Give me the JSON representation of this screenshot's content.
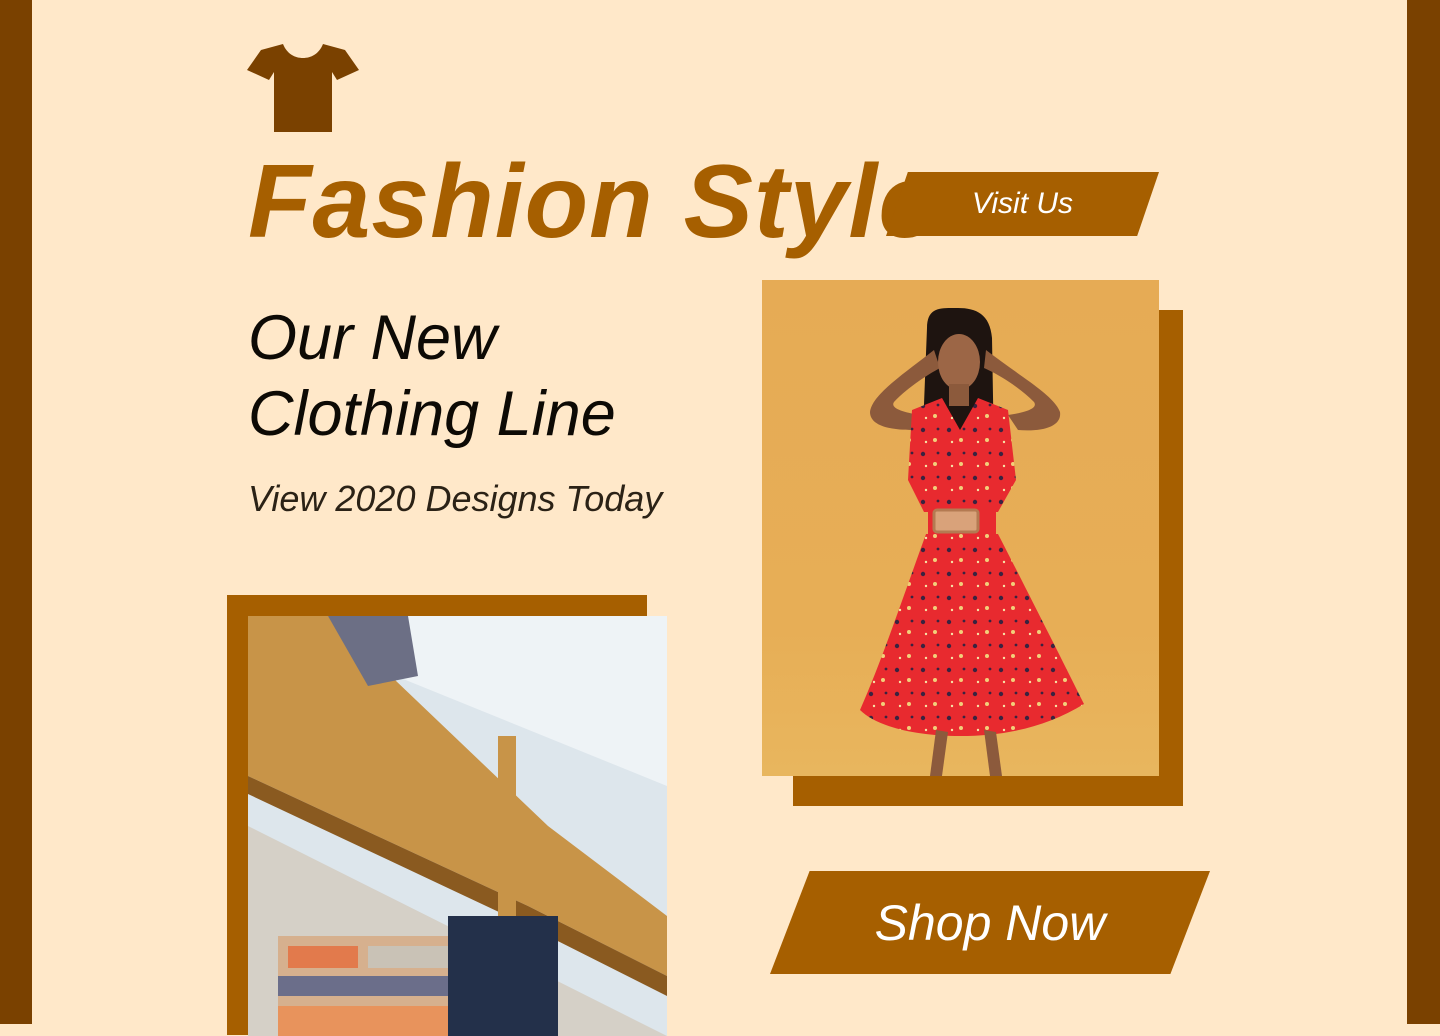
{
  "colors": {
    "background": "#FFE8C9",
    "frame": "#7A4100",
    "accent": "#A65F00",
    "text_dark": "#0D0A05",
    "button_text": "#FFFFFF"
  },
  "logo": {
    "icon": "t-shirt-icon"
  },
  "brand": {
    "title": "Fashion Style"
  },
  "buttons": {
    "visit_label": "Visit Us",
    "shop_label": "Shop Now"
  },
  "hero": {
    "headline_line1": "Our New",
    "headline_line2": "Clothing Line",
    "subline": "View 2020 Designs Today"
  },
  "images": {
    "model": "model-red-dress-photo",
    "shelf": "clothing-shelf-photo"
  }
}
